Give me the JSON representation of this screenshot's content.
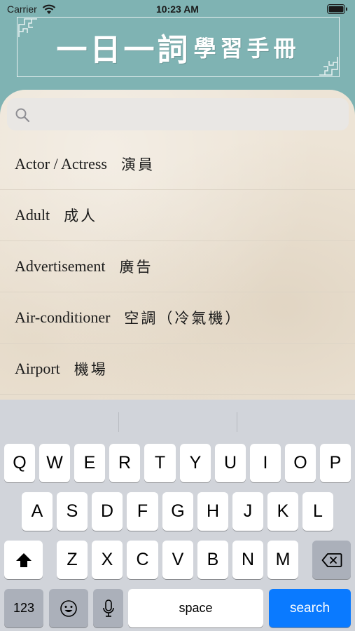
{
  "status_bar": {
    "carrier": "Carrier",
    "time": "10:23 AM"
  },
  "banner": {
    "title_big": "一日一詞",
    "title_small": "學習手冊"
  },
  "search": {
    "value": "",
    "placeholder": ""
  },
  "words": [
    {
      "en": "Actor / Actress",
      "zh": "演員"
    },
    {
      "en": "Adult",
      "zh": "成人"
    },
    {
      "en": "Advertisement",
      "zh": "廣告"
    },
    {
      "en": "Air-conditioner",
      "zh": "空調（冷氣機）"
    },
    {
      "en": "Airport",
      "zh": "機場"
    }
  ],
  "keyboard": {
    "row1": [
      "Q",
      "W",
      "E",
      "R",
      "T",
      "Y",
      "U",
      "I",
      "O",
      "P"
    ],
    "row2": [
      "A",
      "S",
      "D",
      "F",
      "G",
      "H",
      "J",
      "K",
      "L"
    ],
    "row3": [
      "Z",
      "X",
      "C",
      "V",
      "B",
      "N",
      "M"
    ],
    "numbers_label": "123",
    "space_label": "space",
    "search_label": "search"
  },
  "colors": {
    "header_teal": "#7fb3b3",
    "paper": "#ede4d6",
    "keyboard_bg": "#d1d4da",
    "search_key": "#0a7aff"
  }
}
